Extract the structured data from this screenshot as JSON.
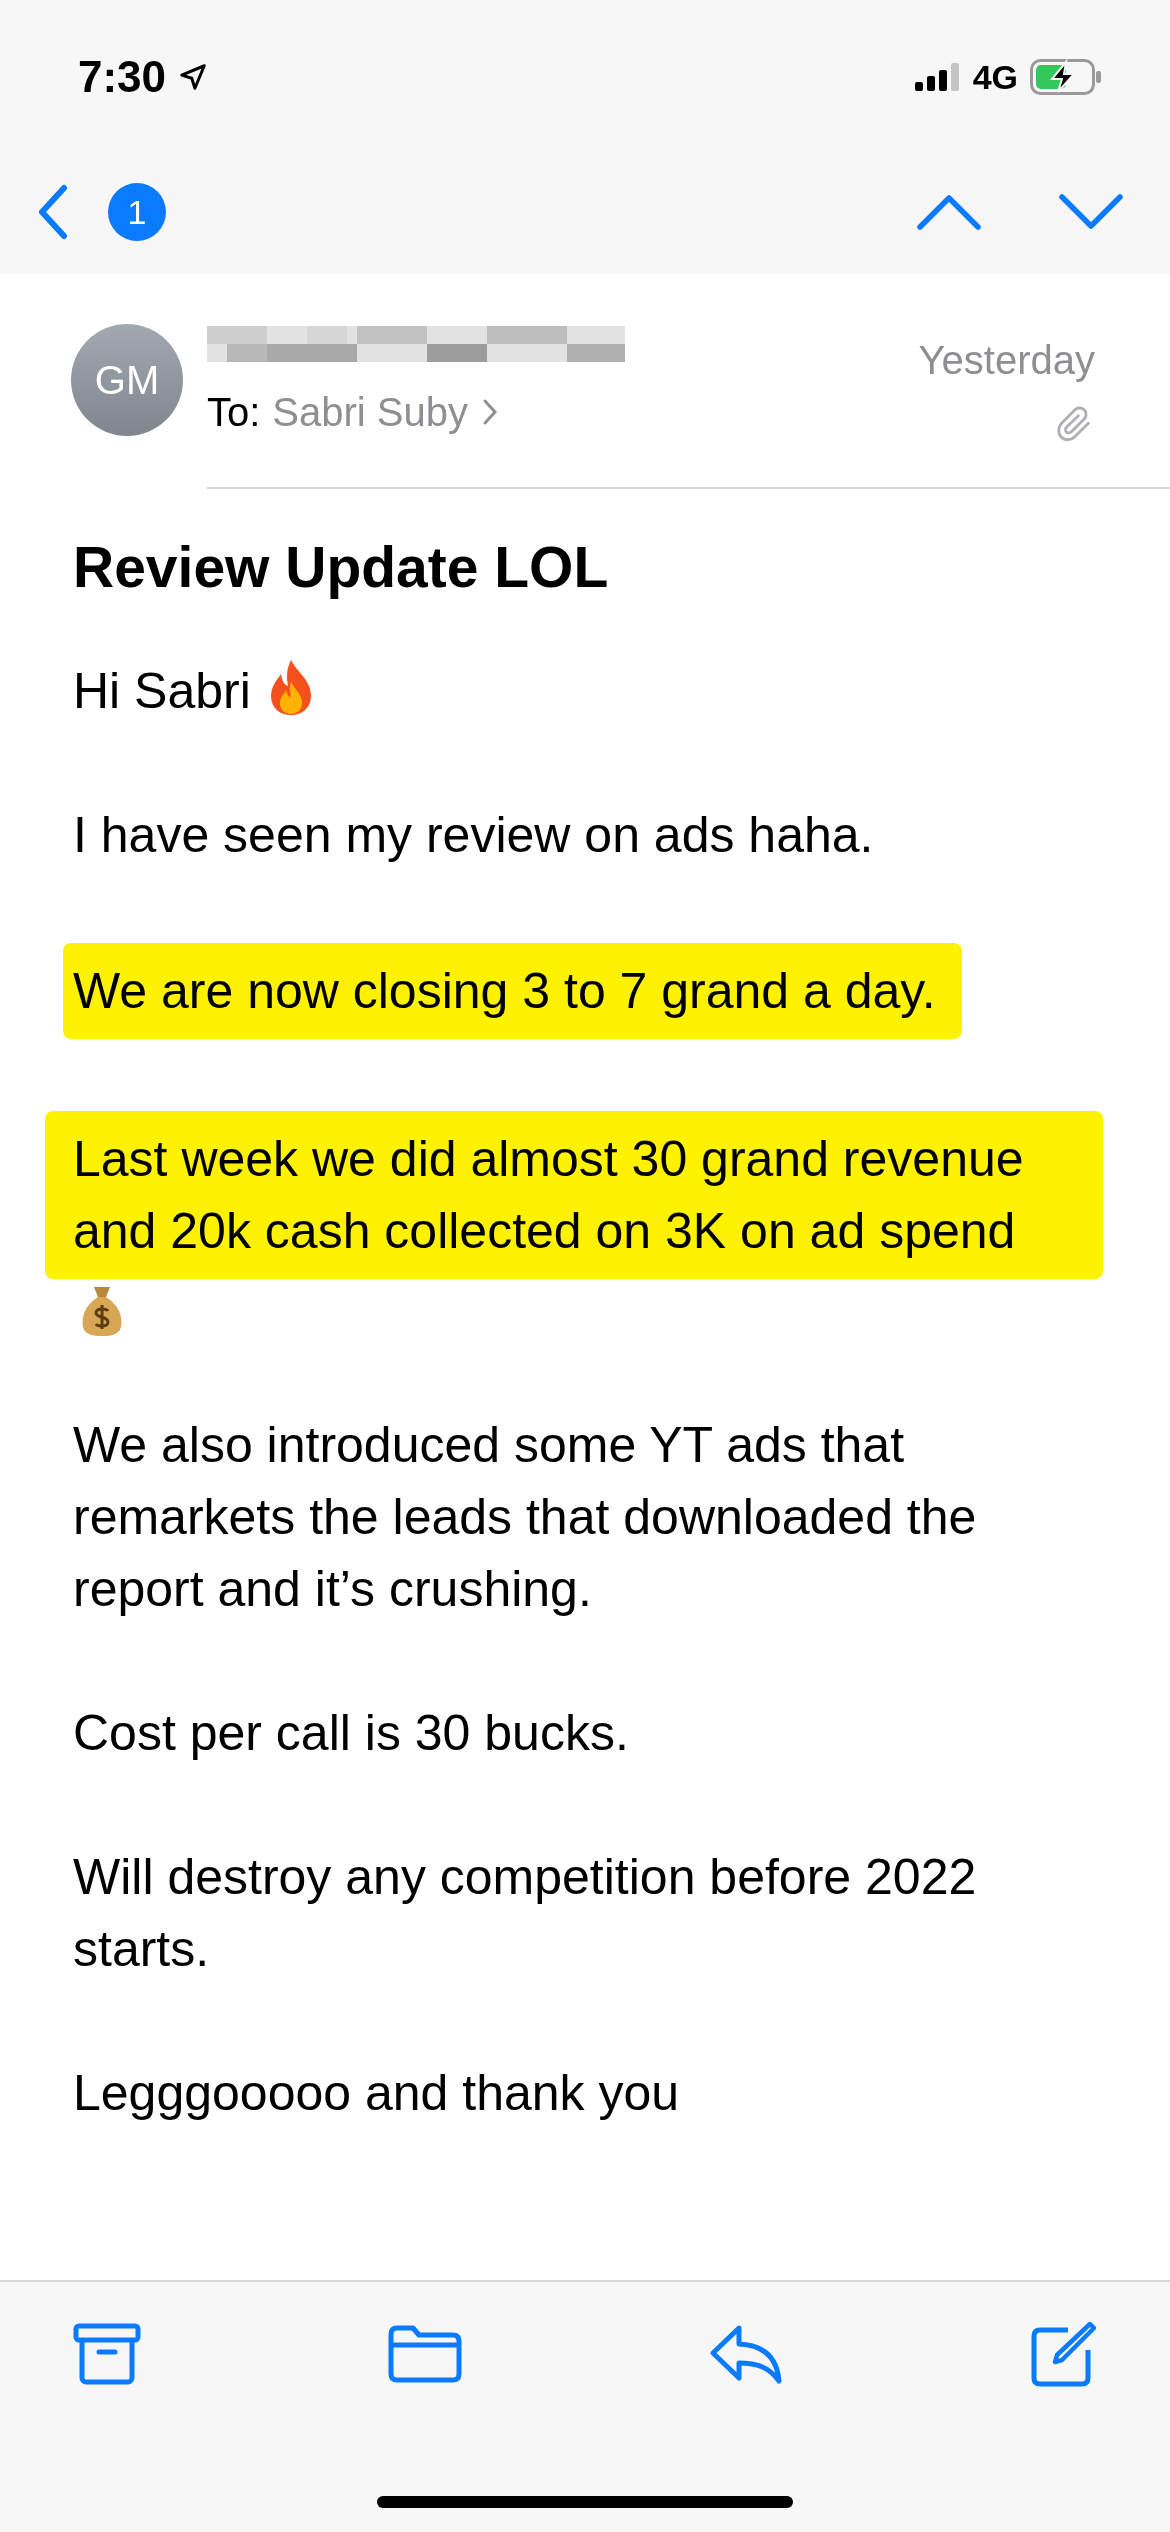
{
  "status_bar": {
    "time": "7:30",
    "network": "4G"
  },
  "nav": {
    "unread_badge": "1"
  },
  "email": {
    "sender_initials": "GM",
    "to_label": "To:",
    "recipient": "Sabri Suby",
    "date": "Yesterday",
    "subject": "Review Update LOL",
    "paragraphs": [
      {
        "text": "Hi Sabri",
        "highlighted": false,
        "kind": "greeting"
      },
      {
        "text": "I have seen my review on ads haha.",
        "highlighted": false
      },
      {
        "text": "We are now closing 3 to 7 grand a day.",
        "highlighted": true
      },
      {
        "text": "Last week we did almost 30 grand revenue and 20k cash collected on 3K on ad spend",
        "highlighted": true,
        "kind": "result"
      },
      {
        "text": "We also introduced some YT ads that remarkets the leads that downloaded the report and it’s crushing.",
        "highlighted": false
      },
      {
        "text": "Cost per call is 30 bucks.",
        "highlighted": false
      },
      {
        "text": "Will destroy any competition before 2022 starts.",
        "highlighted": false
      },
      {
        "text": "Legggooooo and thank you",
        "highlighted": false
      }
    ]
  }
}
